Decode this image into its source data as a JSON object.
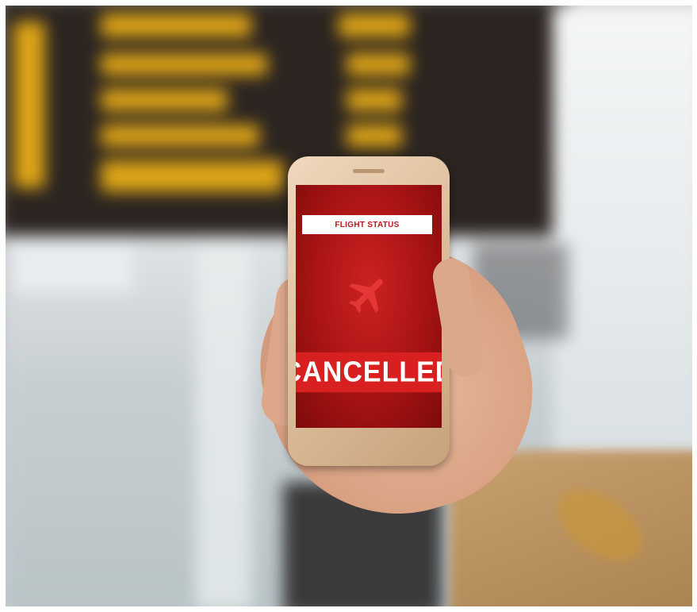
{
  "phone_screen": {
    "header_label": "FLIGHT STATUS",
    "status_text": "CANCELLED",
    "icon": "airplane-icon"
  },
  "colors": {
    "screen_red": "#a71313",
    "banner_red": "#d92020",
    "board_yellow": "#f2b416"
  }
}
